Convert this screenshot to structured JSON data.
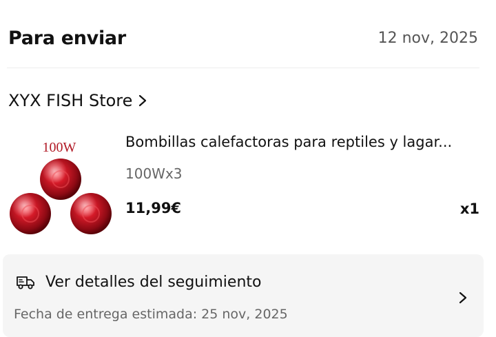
{
  "header": {
    "status_title": "Para enviar",
    "order_date": "12 nov, 2025"
  },
  "store": {
    "name": "XYX FISH Store",
    "chevron_icon": "chevron-right-icon"
  },
  "product": {
    "image_label": "100W",
    "title": "Bombillas calefactoras para reptiles y lagar...",
    "variant": "100Wx3",
    "price": "11,99€",
    "quantity": "x1",
    "bulb_color": "#c0101e"
  },
  "tracking": {
    "label": "Ver detalles del seguimiento",
    "delivery_estimate": "Fecha de entrega estimada: 25 nov, 2025",
    "truck_icon": "truck-icon",
    "chevron_icon": "chevron-right-icon"
  }
}
